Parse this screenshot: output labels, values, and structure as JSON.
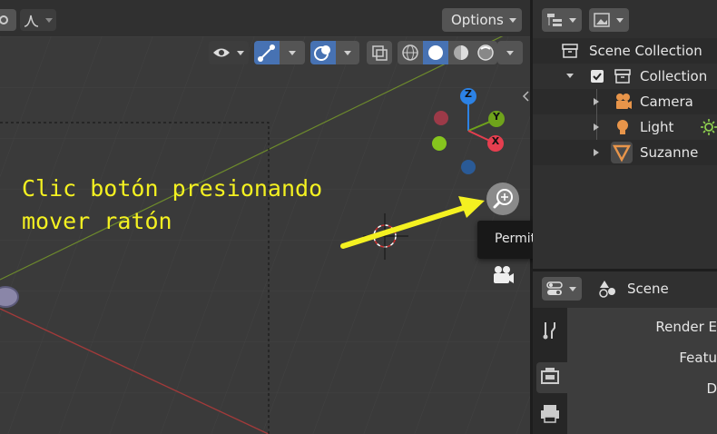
{
  "header": {
    "options_label": "Options"
  },
  "annotation": {
    "line1": "Clic botón presionando",
    "line2": "mover ratón"
  },
  "gizmo": {
    "axis_z": "Z",
    "axis_y": "Y",
    "axis_x": "X"
  },
  "tooltip": {
    "text": "Permite acercar o alejar la vista"
  },
  "outliner": {
    "root": "Scene Collection",
    "collection": "Collection",
    "items": [
      {
        "label": "Camera",
        "icon": "camera-icon"
      },
      {
        "label": "Light",
        "icon": "light-bulb-icon"
      },
      {
        "label": "Suzanne",
        "icon": "mesh-icon"
      }
    ]
  },
  "properties": {
    "scene_label": "Scene",
    "rows": [
      "Render E",
      "Featu",
      "D"
    ]
  },
  "colors": {
    "axis_x": "#e53e4f",
    "axis_y": "#6fa31b",
    "axis_z": "#2c82e5",
    "annotation": "#f4f121",
    "accent": "#4772b3"
  }
}
